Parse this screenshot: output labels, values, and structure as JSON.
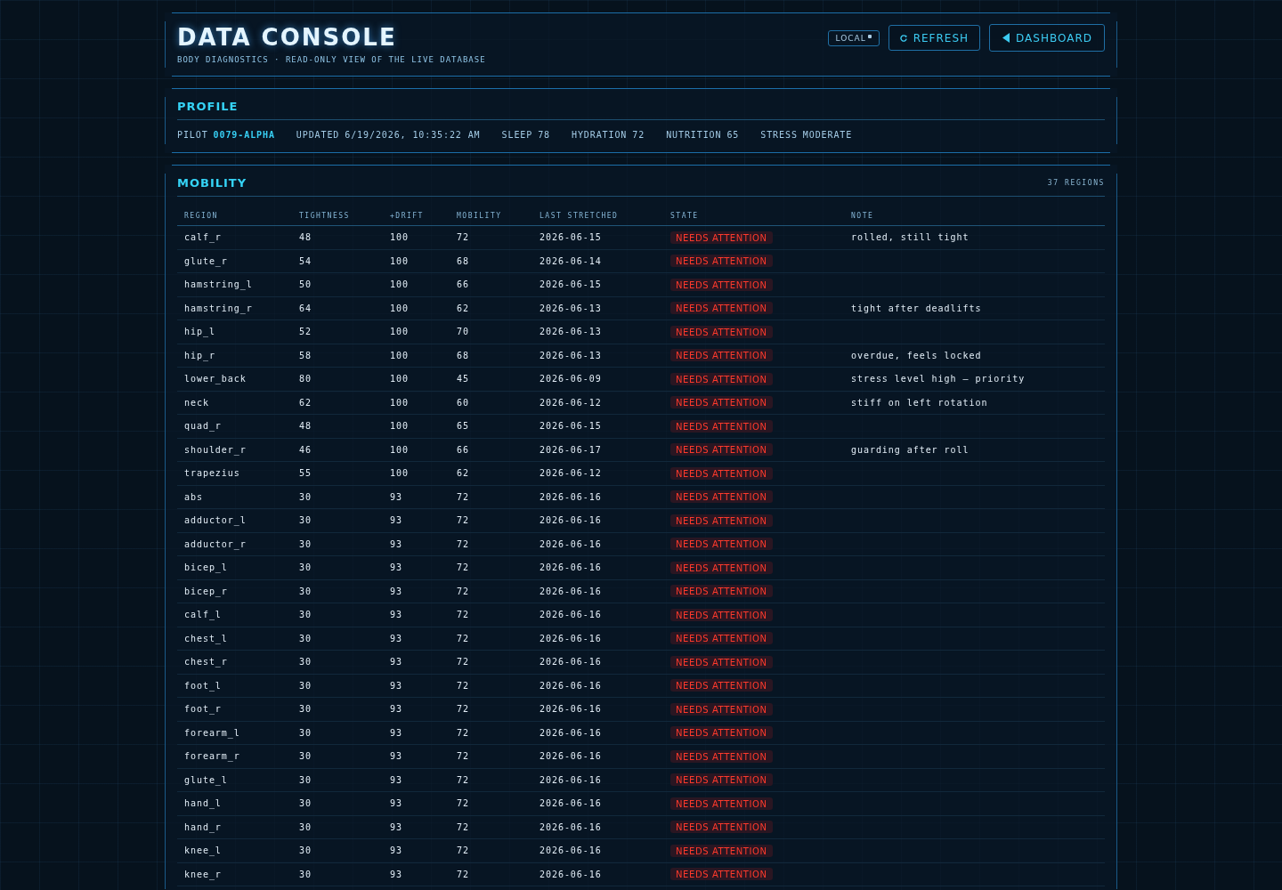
{
  "header": {
    "title": "DATA CONSOLE",
    "subtitle": "BODY DIAGNOSTICS · READ-ONLY VIEW OF THE LIVE DATABASE",
    "mode_tag": "LOCAL",
    "buttons": [
      {
        "kind": "refresh",
        "label": "REFRESH"
      },
      {
        "kind": "back",
        "label": "DASHBOARD"
      }
    ]
  },
  "profile": {
    "title": "PROFILE",
    "fields": [
      {
        "label": "PILOT",
        "value": "0079-ALPHA",
        "highlighted": true
      },
      {
        "label": "UPDATED",
        "value": "6/19/2026, 10:35:22 AM",
        "highlighted": false
      },
      {
        "label": "SLEEP",
        "value": "78",
        "highlighted": false
      },
      {
        "label": "HYDRATION",
        "value": "72",
        "highlighted": false
      },
      {
        "label": "NUTRITION",
        "value": "65",
        "highlighted": false
      },
      {
        "label": "STRESS",
        "value": "MODERATE",
        "highlighted": false
      }
    ]
  },
  "mobility": {
    "title": "MOBILITY",
    "count": "37 REGIONS",
    "table": {
      "columns": [
        {
          "label": "REGION",
          "kind": "text"
        },
        {
          "label": "TIGHTNESS",
          "kind": "text"
        },
        {
          "label": "+DRIFT",
          "kind": "text"
        },
        {
          "label": "MOBILITY",
          "kind": "text"
        },
        {
          "label": "LAST STRETCHED",
          "kind": "text"
        },
        {
          "label": "STATE",
          "kind": "badge"
        },
        {
          "label": "NOTE",
          "kind": "text"
        }
      ],
      "rows": [
        [
          "calf_r",
          "48",
          "100",
          "72",
          "2026-06-15",
          "NEEDS ATTENTION",
          "rolled, still tight"
        ],
        [
          "glute_r",
          "54",
          "100",
          "68",
          "2026-06-14",
          "NEEDS ATTENTION"
        ],
        [
          "hamstring_l",
          "50",
          "100",
          "66",
          "2026-06-15",
          "NEEDS ATTENTION"
        ],
        [
          "hamstring_r",
          "64",
          "100",
          "62",
          "2026-06-13",
          "NEEDS ATTENTION",
          "tight after deadlifts"
        ],
        [
          "hip_l",
          "52",
          "100",
          "70",
          "2026-06-13",
          "NEEDS ATTENTION"
        ],
        [
          "hip_r",
          "58",
          "100",
          "68",
          "2026-06-13",
          "NEEDS ATTENTION",
          "overdue, feels locked"
        ],
        [
          "lower_back",
          "80",
          "100",
          "45",
          "2026-06-09",
          "NEEDS ATTENTION",
          "stress level high — priority"
        ],
        [
          "neck",
          "62",
          "100",
          "60",
          "2026-06-12",
          "NEEDS ATTENTION",
          "stiff on left rotation"
        ],
        [
          "quad_r",
          "48",
          "100",
          "65",
          "2026-06-15",
          "NEEDS ATTENTION"
        ],
        [
          "shoulder_r",
          "46",
          "100",
          "66",
          "2026-06-17",
          "NEEDS ATTENTION",
          "guarding after roll"
        ],
        [
          "trapezius",
          "55",
          "100",
          "62",
          "2026-06-12",
          "NEEDS ATTENTION"
        ],
        [
          "abs",
          "30",
          "93",
          "72",
          "2026-06-16",
          "NEEDS ATTENTION"
        ],
        [
          "adductor_l",
          "30",
          "93",
          "72",
          "2026-06-16",
          "NEEDS ATTENTION"
        ],
        [
          "adductor_r",
          "30",
          "93",
          "72",
          "2026-06-16",
          "NEEDS ATTENTION"
        ],
        [
          "bicep_l",
          "30",
          "93",
          "72",
          "2026-06-16",
          "NEEDS ATTENTION"
        ],
        [
          "bicep_r",
          "30",
          "93",
          "72",
          "2026-06-16",
          "NEEDS ATTENTION"
        ],
        [
          "calf_l",
          "30",
          "93",
          "72",
          "2026-06-16",
          "NEEDS ATTENTION"
        ],
        [
          "chest_l",
          "30",
          "93",
          "72",
          "2026-06-16",
          "NEEDS ATTENTION"
        ],
        [
          "chest_r",
          "30",
          "93",
          "72",
          "2026-06-16",
          "NEEDS ATTENTION"
        ],
        [
          "foot_l",
          "30",
          "93",
          "72",
          "2026-06-16",
          "NEEDS ATTENTION"
        ],
        [
          "foot_r",
          "30",
          "93",
          "72",
          "2026-06-16",
          "NEEDS ATTENTION"
        ],
        [
          "forearm_l",
          "30",
          "93",
          "72",
          "2026-06-16",
          "NEEDS ATTENTION"
        ],
        [
          "forearm_r",
          "30",
          "93",
          "72",
          "2026-06-16",
          "NEEDS ATTENTION"
        ],
        [
          "glute_l",
          "30",
          "93",
          "72",
          "2026-06-16",
          "NEEDS ATTENTION"
        ],
        [
          "hand_l",
          "30",
          "93",
          "72",
          "2026-06-16",
          "NEEDS ATTENTION"
        ],
        [
          "hand_r",
          "30",
          "93",
          "72",
          "2026-06-16",
          "NEEDS ATTENTION"
        ],
        [
          "knee_l",
          "30",
          "93",
          "72",
          "2026-06-16",
          "NEEDS ATTENTION"
        ],
        [
          "knee_r",
          "30",
          "93",
          "72",
          "2026-06-16",
          "NEEDS ATTENTION"
        ]
      ]
    }
  }
}
